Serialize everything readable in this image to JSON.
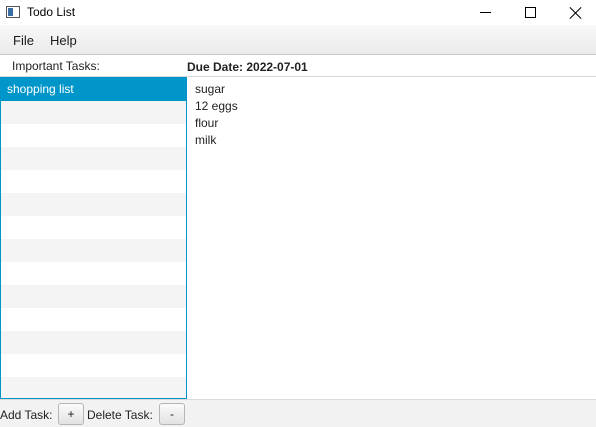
{
  "window": {
    "title": "Todo List",
    "icon": "app-window-icon"
  },
  "menu": {
    "file": "File",
    "help": "Help"
  },
  "tasks_panel": {
    "label": "Important Tasks:",
    "items": [
      "shopping list"
    ],
    "selected_index": 0
  },
  "detail": {
    "due_date": "Due Date: 2022-07-01",
    "lines": [
      "sugar",
      "12 eggs",
      "flour",
      "milk"
    ]
  },
  "bottom": {
    "add_label": "Add Task:",
    "add_button": "+",
    "delete_label": "Delete Task:",
    "delete_button": "-"
  },
  "colors": {
    "selection": "#0096c9",
    "row_alt": "#f4f4f4"
  }
}
